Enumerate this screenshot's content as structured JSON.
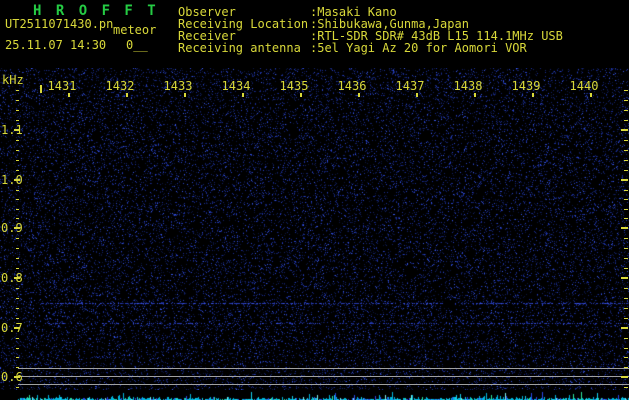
{
  "header": {
    "title": "H R O F F T",
    "filename": "UT2511071430.pn",
    "overlay_word": "meteor",
    "datetime": "25.11.07 14:30",
    "counter": "0__",
    "fields": [
      {
        "label": "Observer",
        "value": ":Masaki Kano"
      },
      {
        "label": "Receiving Location",
        "value": ":Shibukawa,Gunma,Japan"
      },
      {
        "label": "Receiver",
        "value": ":RTL-SDR SDR# 43dB L15 114.1MHz USB"
      },
      {
        "label": "Receiving antenna",
        "value": ":5el Yagi Az 20 for Aomori VOR"
      }
    ]
  },
  "chart_data": {
    "type": "heatmap",
    "description": "HROFFT radio-meteor spectrogram waterfall, 10-minute span, uniform faint blue noise with no strong meteor echoes; weak carrier lines near 0.75 and 0.71 kHz; signal-level meter strip along bottom edge",
    "x_axis": {
      "ticks": [
        "1431",
        "1432",
        "1433",
        "1434",
        "1435",
        "1436",
        "1437",
        "1438",
        "1439",
        "1440"
      ],
      "start_time": "1430",
      "end_time": "1440"
    },
    "y_axis": {
      "unit": "kHz",
      "ticks": [
        "1.1",
        "1.0",
        "0.9",
        "0.8",
        "0.7",
        "0.6"
      ],
      "range": [
        0.6,
        1.2
      ]
    },
    "carrier_lines_khz": [
      0.75,
      0.71
    ],
    "legend": "none",
    "grid": "off"
  },
  "colors": {
    "background": "#000000",
    "title_green": "#25cc44",
    "text_yellow": "#d9d93a",
    "gray_line": "#a0a0a0",
    "noise_palette": [
      "#0b1540",
      "#14226b",
      "#1b2f99",
      "#2a44cc",
      "#3a5aee"
    ],
    "carrier_blue": "#2a3dbb",
    "carrier_bright": "#3c55ee",
    "meter_palette": [
      "#00b8e0",
      "#15d2f0",
      "#2a48e8",
      "#2ee8a0",
      "#7df0f0"
    ]
  }
}
